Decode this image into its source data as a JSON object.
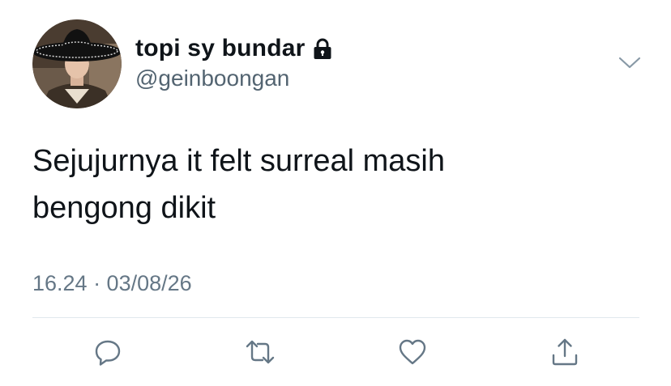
{
  "tweet": {
    "author": {
      "display_name": "topi sy bundar",
      "handle": "@geinboongan",
      "avatar_icon": "avatar-photo-sombrero",
      "protected_icon": "lock-icon"
    },
    "text_line_1": "Sejujurnya it felt surreal masih",
    "text_line_2": "bengong dikit",
    "timestamp": "16.24 · 03/08/26",
    "menu_icon": "chevron-down-icon",
    "actions": {
      "reply_icon": "reply-icon",
      "retweet_icon": "retweet-icon",
      "like_icon": "like-icon",
      "share_icon": "share-icon"
    },
    "colors": {
      "text": "#0f1419",
      "secondary_text": "#536471",
      "icon": "#657786",
      "divider": "#e1e8ed"
    }
  }
}
